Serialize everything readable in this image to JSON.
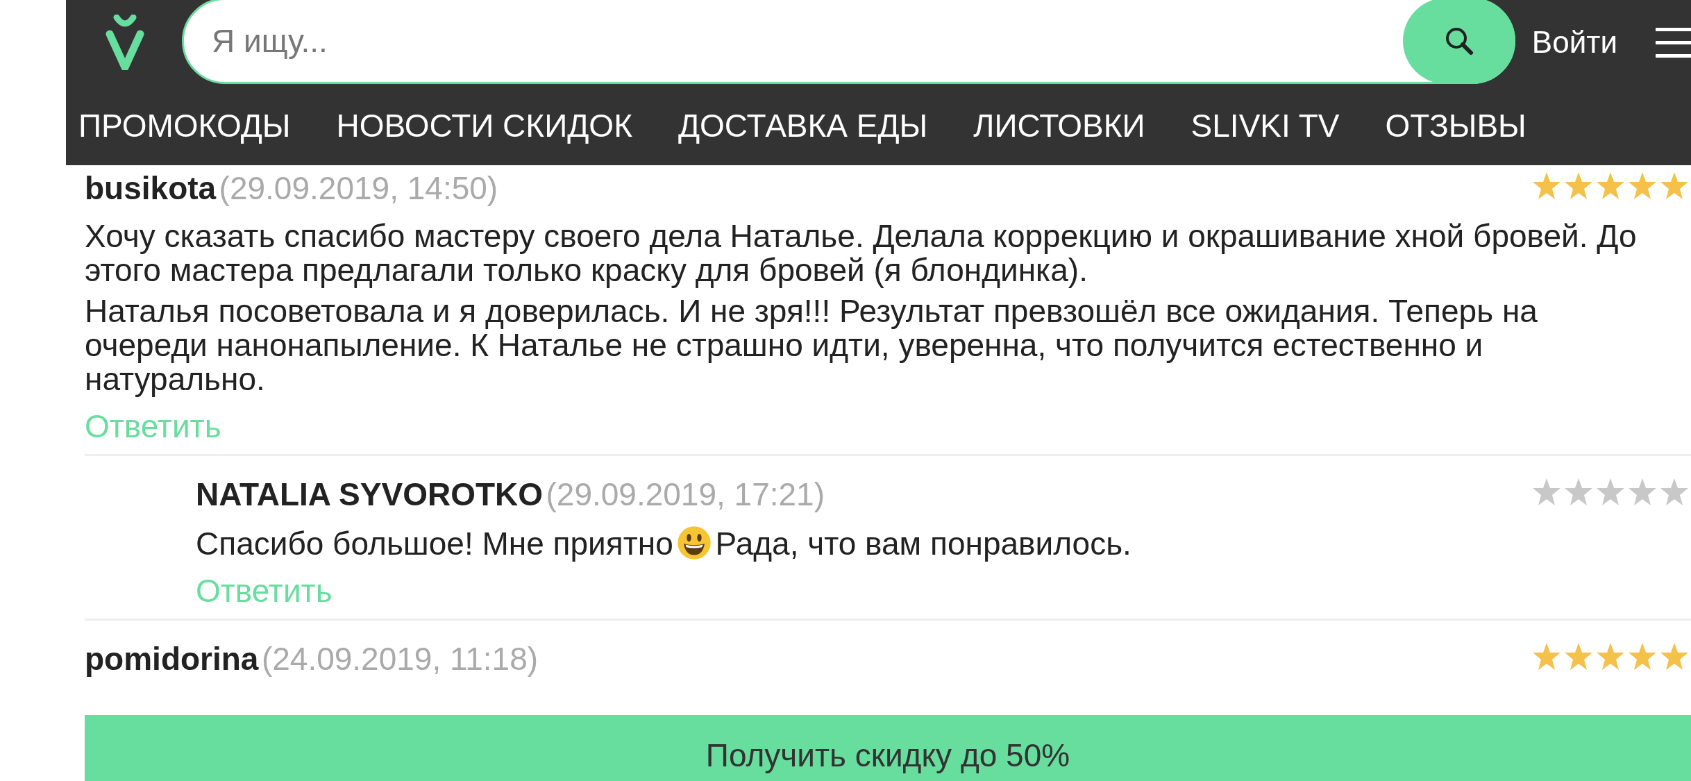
{
  "header": {
    "search": {
      "placeholder": "Я ищу..."
    },
    "login": "Войти"
  },
  "nav": [
    {
      "label": "ПРОМОКОДЫ"
    },
    {
      "label": "НОВОСТИ СКИДОК"
    },
    {
      "label": "ДОСТАВКА ЕДЫ"
    },
    {
      "label": "ЛИСТОВКИ"
    },
    {
      "label": "SLIVKI TV"
    },
    {
      "label": "ОТЗЫВЫ"
    }
  ],
  "reviews": [
    {
      "author": "busikota",
      "date": "(29.09.2019, 14:50)",
      "stars": 5,
      "text": [
        {
          "kind": "text",
          "value": "Хочу сказать спасибо мастеру своего дела Наталье. Делала коррекцию и окрашивание хной бровей. До этого мастера предлагали только краску для бровей (я блондинка)."
        },
        {
          "kind": "break"
        },
        {
          "kind": "text",
          "value": "Наталья посоветовала и я доверилась. И не зря!!! Результат превзошёл все ожидания. Теперь на очереди нанонапыление. К Наталье не страшно идти, уверенна, что получится естественно и натурально."
        }
      ],
      "reply_link": "Ответить",
      "children": [
        {
          "author": "NATALIA SYVOROTKO",
          "date": "(29.09.2019, 17:21)",
          "stars": 0,
          "text": [
            {
              "kind": "text",
              "value": "Спасибо большое! Мне приятно"
            },
            {
              "kind": "emoji"
            },
            {
              "kind": "text",
              "value": "Рада, что вам понравилось."
            }
          ],
          "reply_link": "Ответить"
        }
      ]
    },
    {
      "author": "pomidorina",
      "date": "(24.09.2019, 11:18)",
      "stars": 5
    }
  ],
  "cta": "Получить скидку до 50%"
}
